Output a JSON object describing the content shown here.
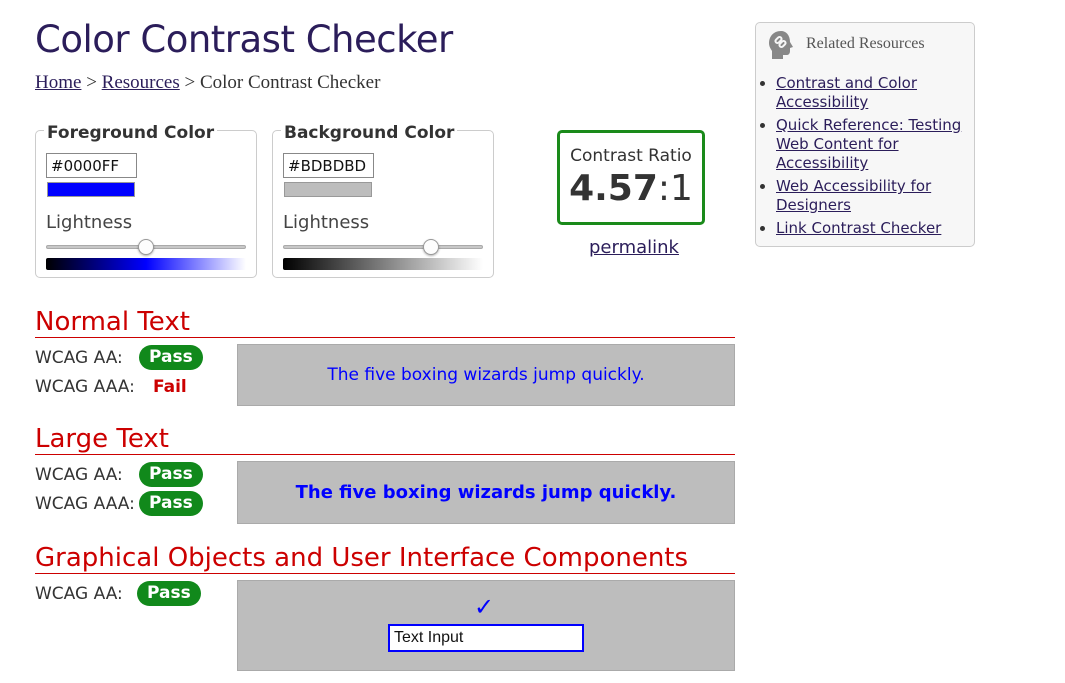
{
  "page": {
    "title": "Color Contrast Checker"
  },
  "breadcrumb": {
    "home": "Home",
    "sep1": " > ",
    "resources": "Resources",
    "sep2": " > ",
    "current": "Color Contrast Checker"
  },
  "foreground": {
    "legend": "Foreground Color",
    "hex": "#0000FF",
    "lightness_label": "Lightness",
    "swatch_color": "#0000FF",
    "lightness_percent": 50
  },
  "background": {
    "legend": "Background Color",
    "hex": "#BDBDBD",
    "lightness_label": "Lightness",
    "swatch_color": "#BDBDBD",
    "lightness_percent": 74
  },
  "contrast": {
    "label": "Contrast Ratio",
    "ratio_main": "4.57",
    "ratio_suffix": ":1",
    "permalink": "permalink",
    "border_color": "#1a8a1a"
  },
  "sections": {
    "normal": {
      "heading": "Normal Text",
      "aa_label": "WCAG AA:",
      "aa_result": "Pass",
      "aaa_label": "WCAG AAA:",
      "aaa_result": "Fail",
      "sample": "The five boxing wizards jump quickly."
    },
    "large": {
      "heading": "Large Text",
      "aa_label": "WCAG AA:",
      "aa_result": "Pass",
      "aaa_label": "WCAG AAA:",
      "aaa_result": "Pass",
      "sample": "The five boxing wizards jump quickly."
    },
    "graphical": {
      "heading": "Graphical Objects and User Interface Components",
      "aa_label": "WCAG AA:",
      "aa_result": "Pass",
      "checkmark": "✓",
      "text_input_value": "Text Input"
    }
  },
  "related": {
    "title": "Related Resources",
    "icon": "head-link-icon",
    "items": [
      {
        "label": "Contrast and Color Accessibility"
      },
      {
        "label": "Quick Reference: Testing Web Content for Accessibility"
      },
      {
        "label": "Web Accessibility for Designers"
      },
      {
        "label": "Link Contrast Checker"
      }
    ]
  },
  "colors": {
    "pass_badge": "#11891b",
    "fail_text": "#cc0000",
    "heading_red": "#cc0000",
    "title_purple": "#2b1d5a",
    "sample_bg": "#BDBDBD",
    "sample_fg": "#0000FF"
  }
}
